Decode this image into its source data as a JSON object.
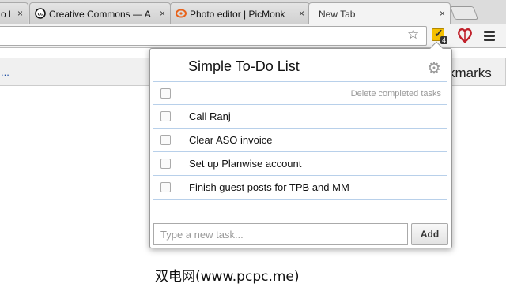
{
  "tabs": [
    {
      "title": "o l",
      "close": "×",
      "active": false
    },
    {
      "title": "Creative Commons — A",
      "close": "×",
      "active": false
    },
    {
      "title": "Photo editor | PicMonk",
      "close": "×",
      "active": false
    },
    {
      "title": "New Tab",
      "close": "×",
      "active": true
    }
  ],
  "toolbar": {
    "star_glyph": "☆",
    "todo_badge_count": "4",
    "menu_icon": "hamburger-menu-icon"
  },
  "page_behind": {
    "bookmark_link": "...",
    "bookmarks_text": "kmarks"
  },
  "popup": {
    "title": "Simple To-Do List",
    "gear_glyph": "⚙",
    "delete_completed_label": "Delete completed tasks",
    "tasks": [
      {
        "label": "Call Ranj",
        "checked": false
      },
      {
        "label": "Clear ASO invoice",
        "checked": false
      },
      {
        "label": "Set up Planwise account",
        "checked": false
      },
      {
        "label": "Finish guest posts for TPB and MM",
        "checked": false
      }
    ],
    "new_task_placeholder": "Type a new task...",
    "add_button_label": "Add"
  },
  "watermark": "双电网(www.pcpc.me)",
  "colors": {
    "rule_line": "#b8d0ea",
    "margin_line": "#f0a0a0",
    "todo_icon": "#f5c000",
    "heart_icon": "#c0202a"
  }
}
